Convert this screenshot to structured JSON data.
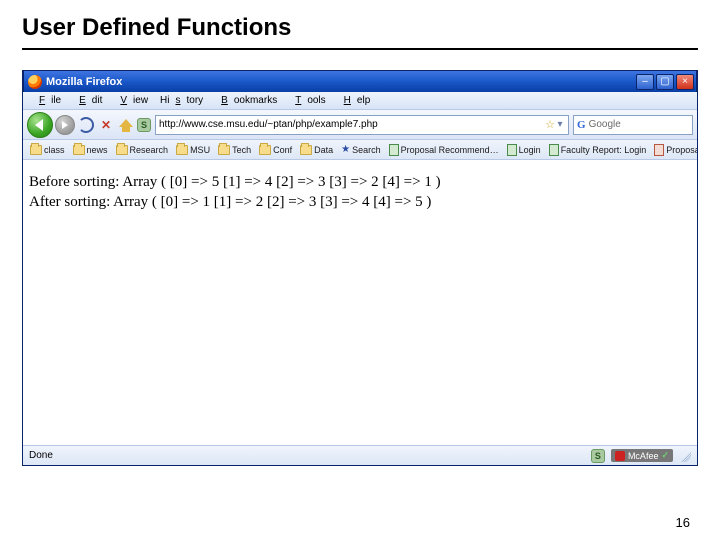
{
  "slide": {
    "title": "User Defined Functions",
    "page_number": "16"
  },
  "window": {
    "app_title": "Mozilla Firefox",
    "win_min": "–",
    "win_max": "▢",
    "win_close": "×"
  },
  "menubar": {
    "file": "File",
    "edit": "Edit",
    "view": "View",
    "history": "History",
    "bookmarks": "Bookmarks",
    "tools": "Tools",
    "help": "Help"
  },
  "toolbar": {
    "url": "http://www.cse.msu.edu/~ptan/php/example7.php",
    "search_placeholder": "Google",
    "star": "☆",
    "dropdown": "▾",
    "s_badge": "S"
  },
  "bookmarks": {
    "items": [
      {
        "label": "class",
        "type": "folder"
      },
      {
        "label": "news",
        "type": "folder"
      },
      {
        "label": "Research",
        "type": "folder"
      },
      {
        "label": "MSU",
        "type": "folder"
      },
      {
        "label": "Tech",
        "type": "folder"
      },
      {
        "label": "Conf",
        "type": "folder"
      },
      {
        "label": "Data",
        "type": "folder"
      },
      {
        "label": "Search",
        "type": "star"
      },
      {
        "label": "Proposal Recommend…",
        "type": "page-green"
      },
      {
        "label": "Login",
        "type": "page-green"
      },
      {
        "label": "Faculty Report: Login",
        "type": "page-green"
      },
      {
        "label": "Proposal Recommend…",
        "type": "page-red"
      }
    ]
  },
  "page": {
    "line1": "Before sorting: Array ( [0] => 5 [1] => 4 [2] => 3 [3] => 2 [4] => 1 )",
    "line2": "After sorting: Array ( [0] => 1 [1] => 2 [2] => 3 [3] => 4 [4] => 5 )"
  },
  "status": {
    "text": "Done",
    "s_badge": "S",
    "mcafee": "McAfee",
    "check": "✓"
  }
}
